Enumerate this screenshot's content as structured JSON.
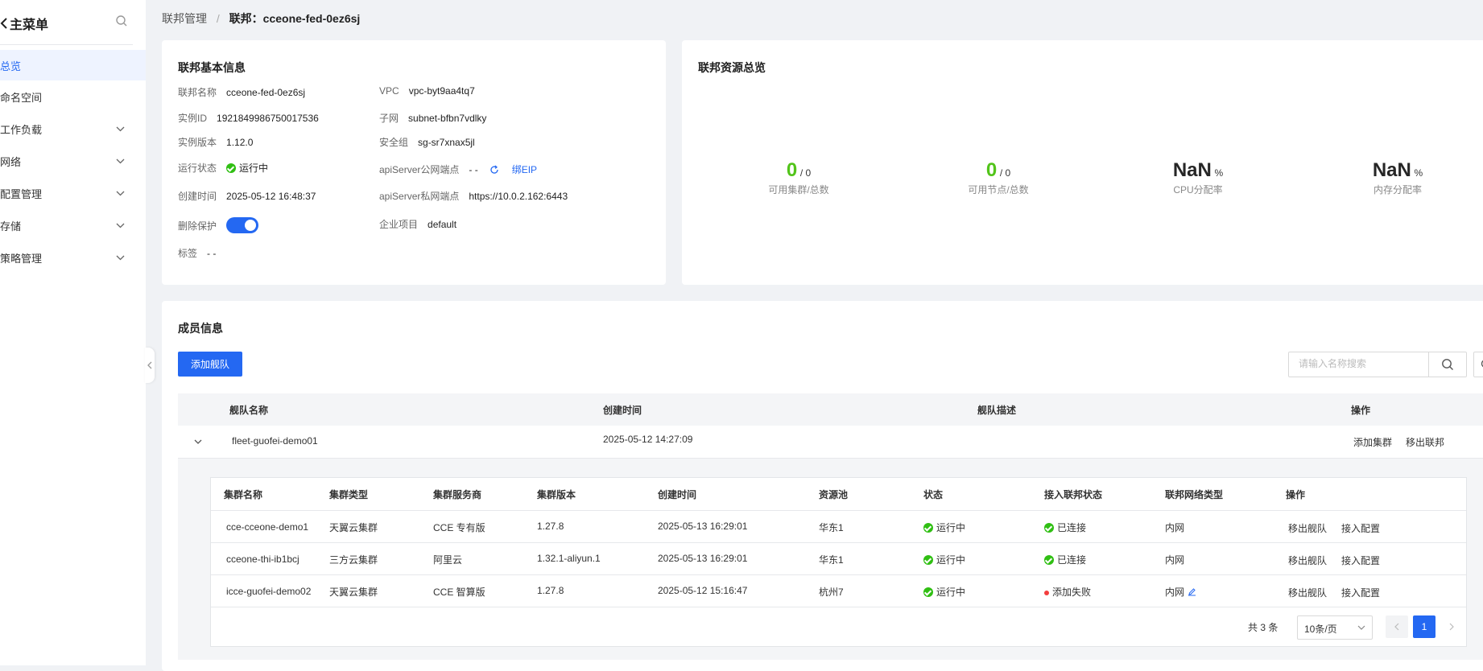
{
  "sidebar": {
    "back_label": "主菜单",
    "items": [
      {
        "label": "总览",
        "active": true,
        "expandable": false
      },
      {
        "label": "命名空间",
        "active": false,
        "expandable": false
      },
      {
        "label": "工作负载",
        "active": false,
        "expandable": true
      },
      {
        "label": "网络",
        "active": false,
        "expandable": true
      },
      {
        "label": "配置管理",
        "active": false,
        "expandable": true
      },
      {
        "label": "存储",
        "active": false,
        "expandable": true
      },
      {
        "label": "策略管理",
        "active": false,
        "expandable": true
      }
    ]
  },
  "breadcrumb": {
    "parent": "联邦管理",
    "separator": "/",
    "current": "联邦：cceone-fed-0ez6sj"
  },
  "basic_info": {
    "title": "联邦基本信息",
    "name_label": "联邦名称",
    "name_value": "cceone-fed-0ez6sj",
    "id_label": "实例ID",
    "id_value": "1921849986750017536",
    "version_label": "实例版本",
    "version_value": "1.12.0",
    "status_label": "运行状态",
    "status_value": "运行中",
    "created_label": "创建时间",
    "created_value": "2025-05-12 16:48:37",
    "protect_label": "删除保护",
    "protect_on": true,
    "tag_label": "标签",
    "tag_value": "- -",
    "vpc_label": "VPC",
    "vpc_value": "vpc-byt9aa4tq7",
    "subnet_label": "子网",
    "subnet_value": "subnet-bfbn7vdlky",
    "sg_label": "安全组",
    "sg_value": "sg-sr7xnax5jl",
    "public_label": "apiServer公网端点",
    "public_value": "- -",
    "bind_eip": "绑EIP",
    "private_label": "apiServer私网端点",
    "private_value": "https://10.0.2.162:6443",
    "project_label": "企业项目",
    "project_value": "default"
  },
  "overview": {
    "title": "联邦资源总览",
    "clusters": {
      "value": "0",
      "total": "/ 0",
      "label": "可用集群/总数"
    },
    "nodes": {
      "value": "0",
      "total": "/ 0",
      "label": "可用节点/总数"
    },
    "cpu": {
      "value": "NaN",
      "unit": "%",
      "label": "CPU分配率"
    },
    "memory": {
      "value": "NaN",
      "unit": "%",
      "label": "内存分配率"
    }
  },
  "members": {
    "title": "成员信息",
    "add_fleet": "添加舰队",
    "search_placeholder": "请输入名称搜索",
    "columns": [
      "舰队名称",
      "创建时间",
      "舰队描述",
      "操作"
    ],
    "fleet": {
      "name": "fleet-guofei-demo01",
      "created": "2025-05-12 14:27:09",
      "desc": "",
      "action_add": "添加集群",
      "action_remove": "移出联邦"
    },
    "clusters": {
      "columns": [
        "集群名称",
        "集群类型",
        "集群服务商",
        "集群版本",
        "创建时间",
        "资源池",
        "状态",
        "接入联邦状态",
        "联邦网络类型",
        "操作"
      ],
      "rows": [
        {
          "name": "cce-cceone-demo1",
          "type": "天翼云集群",
          "provider": "CCE 专有版",
          "version": "1.27.8",
          "created": "2025-05-13 16:29:01",
          "pool": "华东1",
          "status": "运行中",
          "join": "已连接",
          "join_ok": true,
          "net": "内网",
          "a1": "移出舰队",
          "a2": "接入配置"
        },
        {
          "name": "cceone-thi-ib1bcj",
          "type": "三方云集群",
          "provider": "阿里云",
          "version": "1.32.1-aliyun.1",
          "created": "2025-05-13 16:29:01",
          "pool": "华东1",
          "status": "运行中",
          "join": "已连接",
          "join_ok": true,
          "net": "内网",
          "a1": "移出舰队",
          "a2": "接入配置"
        },
        {
          "name": "icce-guofei-demo02",
          "type": "天翼云集群",
          "provider": "CCE 智算版",
          "version": "1.27.8",
          "created": "2025-05-12 15:16:47",
          "pool": "杭州7",
          "status": "运行中",
          "join": "添加失败",
          "join_ok": false,
          "net": "内网",
          "a1": "移出舰队",
          "a2": "接入配置"
        }
      ],
      "total": "共 3 条",
      "page_size": "10条/页",
      "current_page": "1"
    }
  },
  "colors": {
    "primary": "#2468f2",
    "success": "#52c41a",
    "danger": "#f33e3e"
  }
}
